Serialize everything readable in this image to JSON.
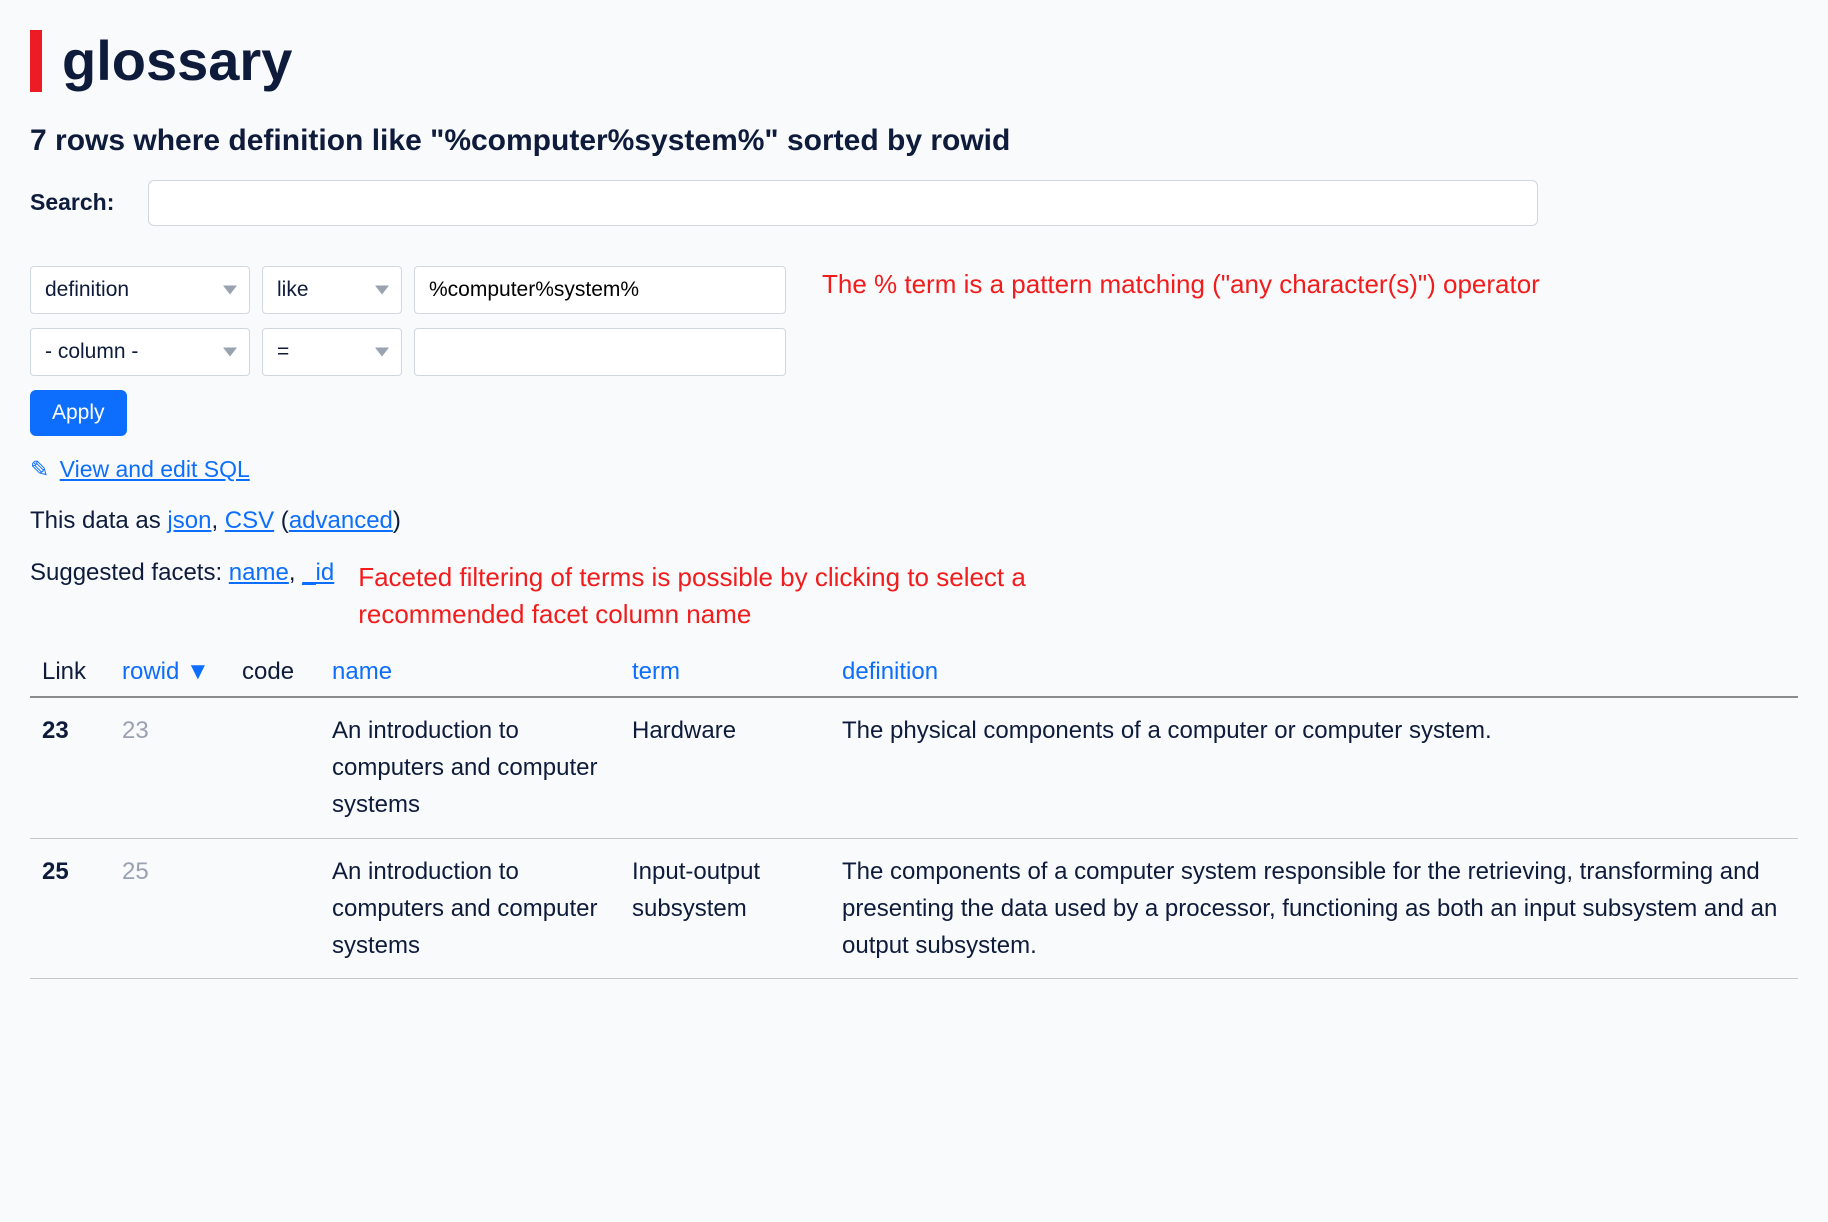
{
  "title": "glossary",
  "subheading": "7 rows where definition like \"%computer%system%\" sorted by rowid",
  "search": {
    "label": "Search:",
    "value": ""
  },
  "filters": [
    {
      "column": "definition",
      "op": "like",
      "value": "%computer%system%"
    },
    {
      "column": "- column -",
      "op": "=",
      "value": ""
    }
  ],
  "apply_label": "Apply",
  "annotation_pattern": "The % term is a pattern matching (\"any character(s)\") operator",
  "sql_link": "View and edit SQL",
  "data_as": {
    "prefix": "This data as ",
    "json": "json",
    "csv": "CSV",
    "advanced": "advanced"
  },
  "facets": {
    "prefix": "Suggested facets: ",
    "items": [
      "name",
      "_id"
    ]
  },
  "annotation_facets": "Faceted filtering of terms is possible by clicking to select a recommended facet column name",
  "table": {
    "headers": {
      "link": "Link",
      "rowid": "rowid ▼",
      "code": "code",
      "name": "name",
      "term": "term",
      "definition": "definition"
    },
    "rows": [
      {
        "link": "23",
        "rowid": "23",
        "code": "",
        "name": "An introduction to computers and computer systems",
        "term": "Hardware",
        "definition": "The physical components of a computer or computer system."
      },
      {
        "link": "25",
        "rowid": "25",
        "code": "",
        "name": "An introduction to computers and computer systems",
        "term": "Input-output subsystem",
        "definition": "The components of a computer system responsible for the retrieving, transforming and presenting the data used by a processor, functioning as both an input subsystem and an output subsystem."
      }
    ]
  }
}
